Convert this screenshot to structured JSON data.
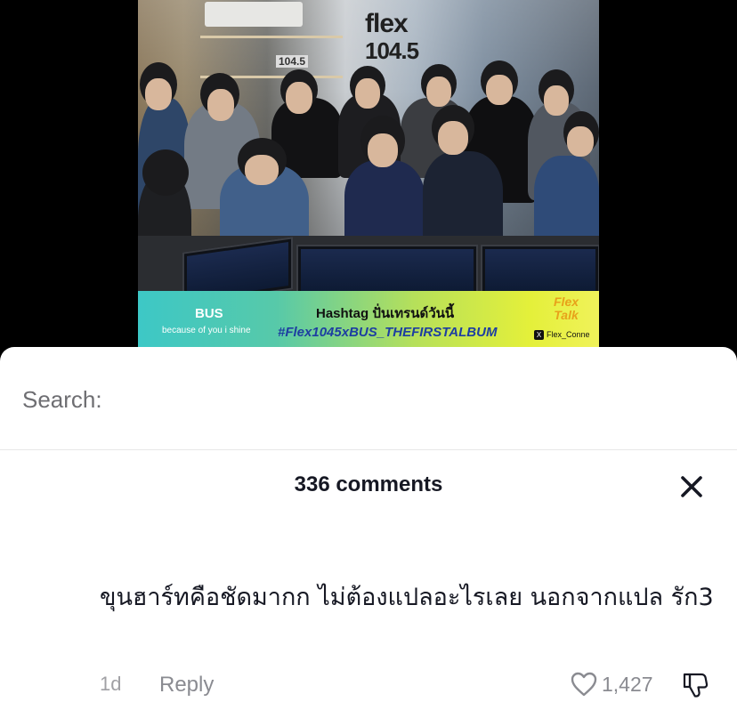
{
  "video": {
    "overlay_number": "104.5",
    "logo_text_line1": "flex",
    "logo_text_line2": "104.5",
    "banner": {
      "band_name": "BUS",
      "band_subtitle": "because of you i shine",
      "hashtag_label": "Hashtag ปั่นเทรนด์วันนี้",
      "hashtag": "#Flex1045xBUS_THEFIRSTALBUM",
      "show_name_line1": "Flex",
      "show_name_line2": "Talk",
      "social_handle": "Flex_Conne",
      "social_icon": "x-icon",
      "colors": {
        "start": "#3dc8c6",
        "end": "#f0f25a",
        "hashtag": "#1d3ea1"
      }
    }
  },
  "search": {
    "label": "Search:"
  },
  "comments_panel": {
    "title": "336 comments",
    "close_icon": "close-icon"
  },
  "comment": {
    "text": "ขุนฮาร์ทคือชัดมากก ไม่ต้องแปลอะไรเลย นอกจากแปล รัก3",
    "time": "1d",
    "reply_label": "Reply",
    "like_icon": "heart-icon",
    "like_count": "1,427",
    "dislike_icon": "thumbs-down-icon"
  }
}
